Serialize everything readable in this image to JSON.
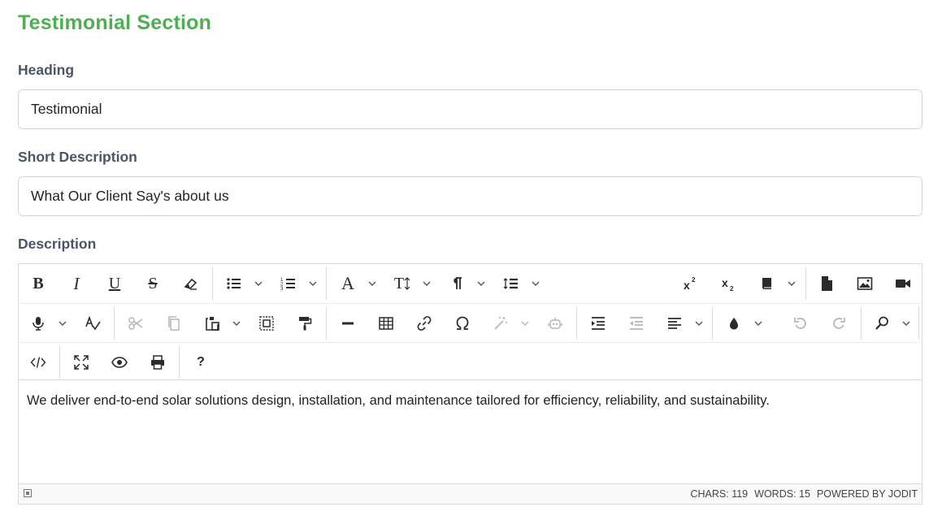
{
  "section": {
    "title": "Testimonial Section"
  },
  "heading": {
    "label": "Heading",
    "value": "Testimonial"
  },
  "short_description": {
    "label": "Short Description",
    "value": "What Our Client Say's about us"
  },
  "description": {
    "label": "Description",
    "content": "We deliver end-to-end solar solutions design, installation, and maintenance tailored for efficiency, reliability, and sustainability.",
    "toolbar_glyphs": {
      "bold": "B",
      "italic": "I",
      "underline": "U",
      "strike": "S",
      "font": "A",
      "font_size": "T",
      "help": "?"
    },
    "status": {
      "chars": "Chars: 119",
      "words": "Words: 15",
      "powered": "Powered by Jodit"
    }
  },
  "colors": {
    "accent": "#4caf50",
    "label": "#4a5568",
    "border": "#d2d6dc"
  }
}
